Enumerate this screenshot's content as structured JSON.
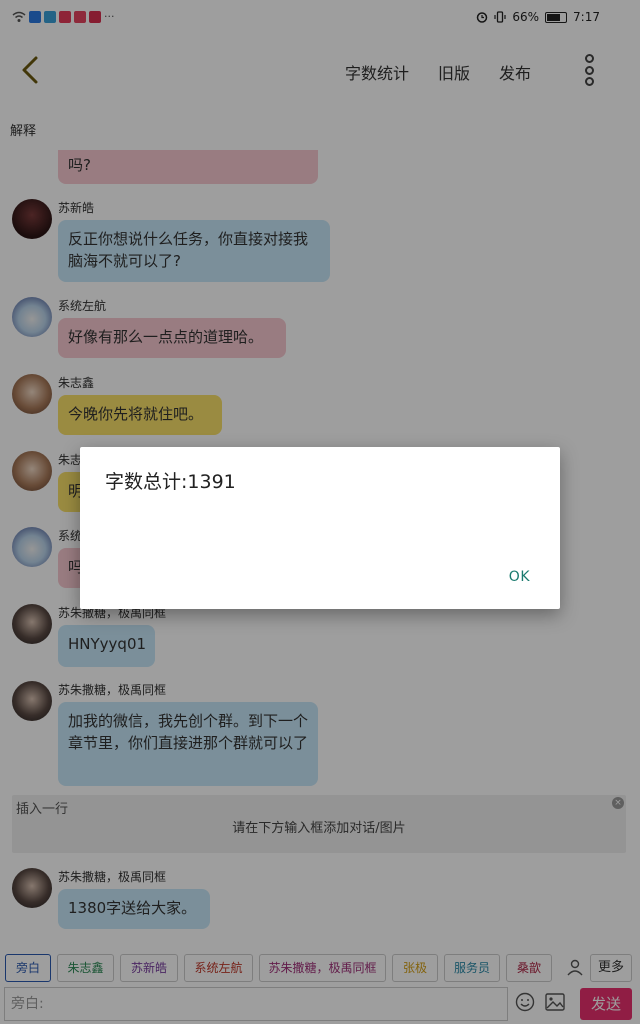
{
  "status_bar": {
    "battery": "66%",
    "time": "7:17",
    "battery_level": 0.66
  },
  "top_bar": {
    "word_count_label": "字数统计",
    "old_version_label": "旧版",
    "publish_label": "发布"
  },
  "section_label": "解释",
  "messages": [
    {
      "name": "",
      "text": "吗?"
    },
    {
      "name": "苏新皓",
      "text": "反正你想说什么任务，你直接对接我脑海不就可以了?"
    },
    {
      "name": "系统左航",
      "text": "好像有那么一点点的道理哈。"
    },
    {
      "name": "朱志鑫",
      "text": "今晚你先将就住吧。"
    },
    {
      "name": "朱志",
      "text": "明"
    },
    {
      "name": "系统",
      "text": "吗"
    },
    {
      "name": "苏朱撒糖，极禹同框",
      "text": "HNYyyq01"
    },
    {
      "name": "苏朱撒糖，极禹同框",
      "text": "加我的微信，我先创个群。到下一个章节里，你们直接进那个群就可以了"
    },
    {
      "name": "苏朱撒糖，极禹同框",
      "text": "1380字送给大家。"
    }
  ],
  "insert_row": {
    "title": "插入一行",
    "hint": "请在下方输入框添加对话/图片",
    "close": "×"
  },
  "role_chips": [
    "旁白",
    "朱志鑫",
    "苏新皓",
    "系统左航",
    "苏朱撒糖，极禹同框",
    "张极",
    "服务员",
    "桑歆"
  ],
  "more_label": "更多",
  "input": {
    "placeholder": "旁白:",
    "send_label": "发送"
  },
  "dialog": {
    "message": "字数总计:1391",
    "ok_label": "OK"
  },
  "colors": {
    "bubble_pink": "#f7c8d0",
    "bubble_blue": "#c7e7f8",
    "bubble_yellow": "#f9e06a",
    "send_button": "#e9306f",
    "dialog_ok": "#1a7a6e",
    "chip_zhuzhixin": "#2e8b57",
    "chip_suxinhao": "#7a3fa0",
    "chip_zuohang": "#c0392b",
    "chip_sutang": "#a0307a",
    "chip_zhangji": "#d4a017",
    "chip_waiter": "#2a8aa8",
    "chip_sangxin": "#b02a4a"
  },
  "icons": [
    "back-arrow-icon",
    "more-vertical-icon",
    "person-icon",
    "emoji-icon",
    "image-icon",
    "wifi-icon",
    "alarm-icon",
    "vibrate-icon",
    "battery-icon"
  ]
}
